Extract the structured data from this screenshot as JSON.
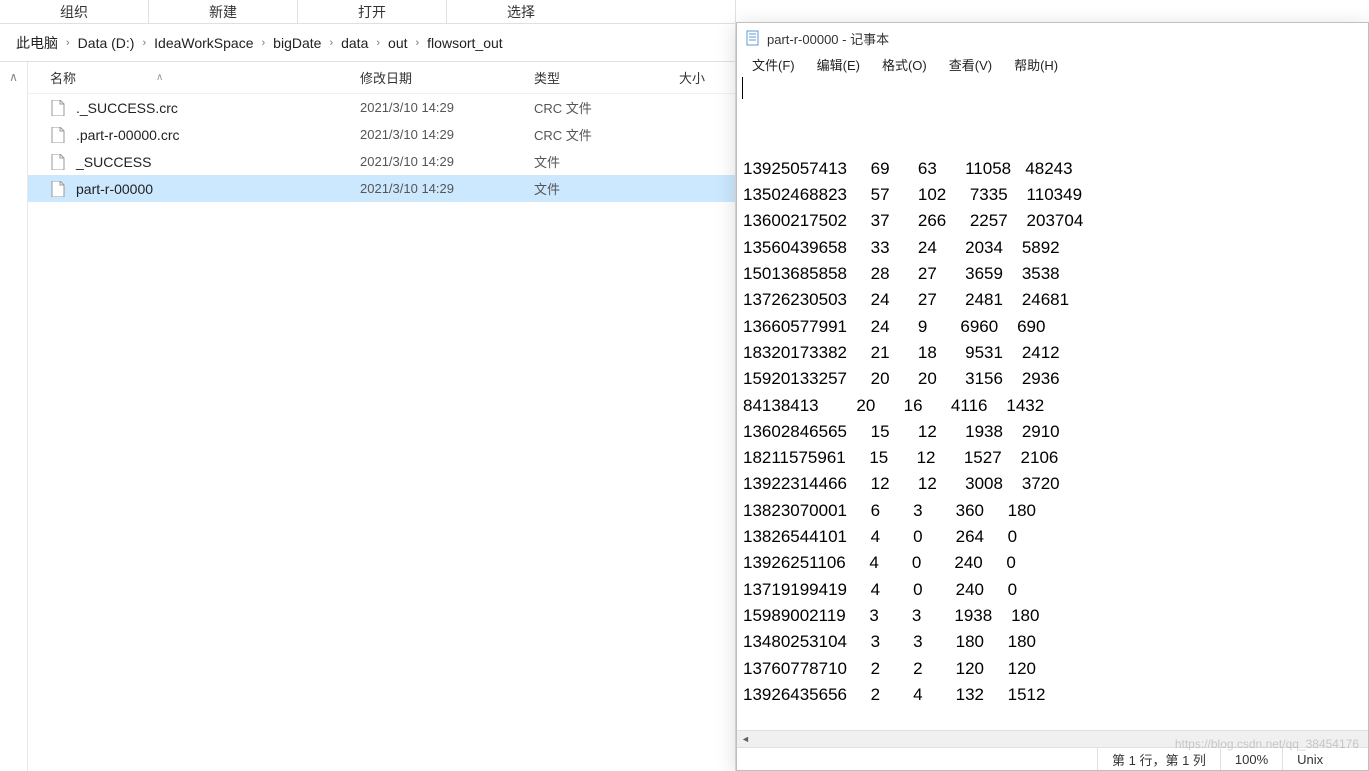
{
  "explorer": {
    "ribbon": [
      "组织",
      "新建",
      "打开",
      "选择"
    ],
    "breadcrumb": [
      "此电脑",
      "Data (D:)",
      "IdeaWorkSpace",
      "bigDate",
      "data",
      "out",
      "flowsort_out"
    ],
    "columns": {
      "name": "名称",
      "date": "修改日期",
      "type": "类型",
      "size": "大小"
    },
    "files": [
      {
        "name": "._SUCCESS.crc",
        "date": "2021/3/10 14:29",
        "type": "CRC 文件",
        "selected": false
      },
      {
        "name": ".part-r-00000.crc",
        "date": "2021/3/10 14:29",
        "type": "CRC 文件",
        "selected": false
      },
      {
        "name": "_SUCCESS",
        "date": "2021/3/10 14:29",
        "type": "文件",
        "selected": false
      },
      {
        "name": "part-r-00000",
        "date": "2021/3/10 14:29",
        "type": "文件",
        "selected": true
      }
    ]
  },
  "notepad": {
    "title": "part-r-00000 - 记事本",
    "menus": [
      "文件(F)",
      "编辑(E)",
      "格式(O)",
      "查看(V)",
      "帮助(H)"
    ],
    "rows": [
      [
        "13925057413",
        "69",
        "63",
        "11058",
        "48243"
      ],
      [
        "13502468823",
        "57",
        "102",
        "7335",
        "110349"
      ],
      [
        "13600217502",
        "37",
        "266",
        "2257",
        "203704"
      ],
      [
        "13560439658",
        "33",
        "24",
        "2034",
        "5892"
      ],
      [
        "15013685858",
        "28",
        "27",
        "3659",
        "3538"
      ],
      [
        "13726230503",
        "24",
        "27",
        "2481",
        "24681"
      ],
      [
        "13660577991",
        "24",
        "9",
        "6960",
        "690"
      ],
      [
        "18320173382",
        "21",
        "18",
        "9531",
        "2412"
      ],
      [
        "15920133257",
        "20",
        "20",
        "3156",
        "2936"
      ],
      [
        "84138413",
        "20",
        "16",
        "4116",
        "1432"
      ],
      [
        "13602846565",
        "15",
        "12",
        "1938",
        "2910"
      ],
      [
        "18211575961",
        "15",
        "12",
        "1527",
        "2106"
      ],
      [
        "13922314466",
        "12",
        "12",
        "3008",
        "3720"
      ],
      [
        "13823070001",
        "6",
        "3",
        "360",
        "180"
      ],
      [
        "13826544101",
        "4",
        "0",
        "264",
        "0"
      ],
      [
        "13926251106",
        "4",
        "0",
        "240",
        "0"
      ],
      [
        "13719199419",
        "4",
        "0",
        "240",
        "0"
      ],
      [
        "15989002119",
        "3",
        "3",
        "1938",
        "180"
      ],
      [
        "13480253104",
        "3",
        "3",
        "180",
        "180"
      ],
      [
        "13760778710",
        "2",
        "2",
        "120",
        "120"
      ],
      [
        "13926435656",
        "2",
        "4",
        "132",
        "1512"
      ]
    ],
    "status": {
      "position": "第 1 行，第 1 列",
      "zoom": "100%",
      "encoding": "Unix"
    }
  },
  "watermark": "https://blog.csdn.net/qq_38454176"
}
